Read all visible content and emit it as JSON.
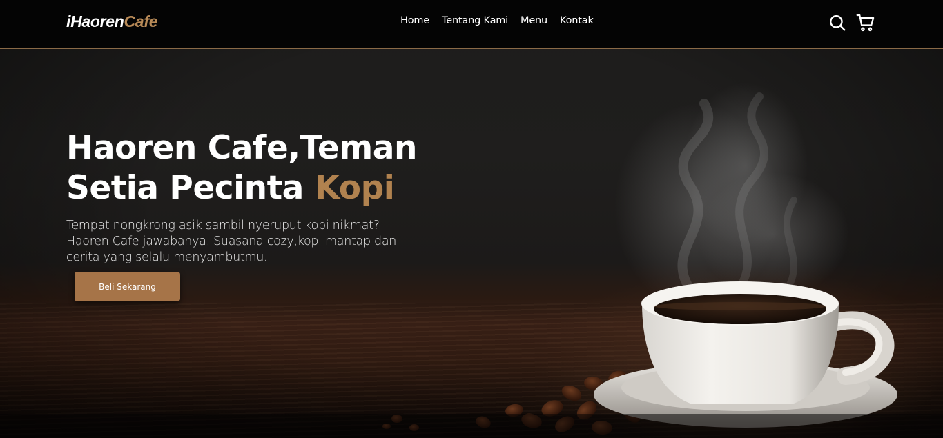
{
  "brand": {
    "logo_part1": "iHaoren",
    "logo_part2": "Cafe",
    "accent_color": "#b1824f",
    "navbar_border_color": "#8a6a47"
  },
  "nav": {
    "links": [
      {
        "label": "Home"
      },
      {
        "label": "Tentang Kami"
      },
      {
        "label": "Menu"
      },
      {
        "label": "Kontak"
      }
    ],
    "icons": [
      "search-icon",
      "cart-icon"
    ]
  },
  "hero": {
    "title_line1": "Haoren Cafe,Teman",
    "title_line2_prefix": "Setia Pecinta ",
    "title_line2_accent": "Kopi",
    "description": "Tempat nongkrong asik sambil nyeruput kopi nikmat? Haoren Cafe jawabanya. Suasana cozy,kopi mantap dan cerita yang selalu menyambutmu.",
    "cta_label": "Beli Sekarang",
    "cta_color": "#a67448"
  }
}
